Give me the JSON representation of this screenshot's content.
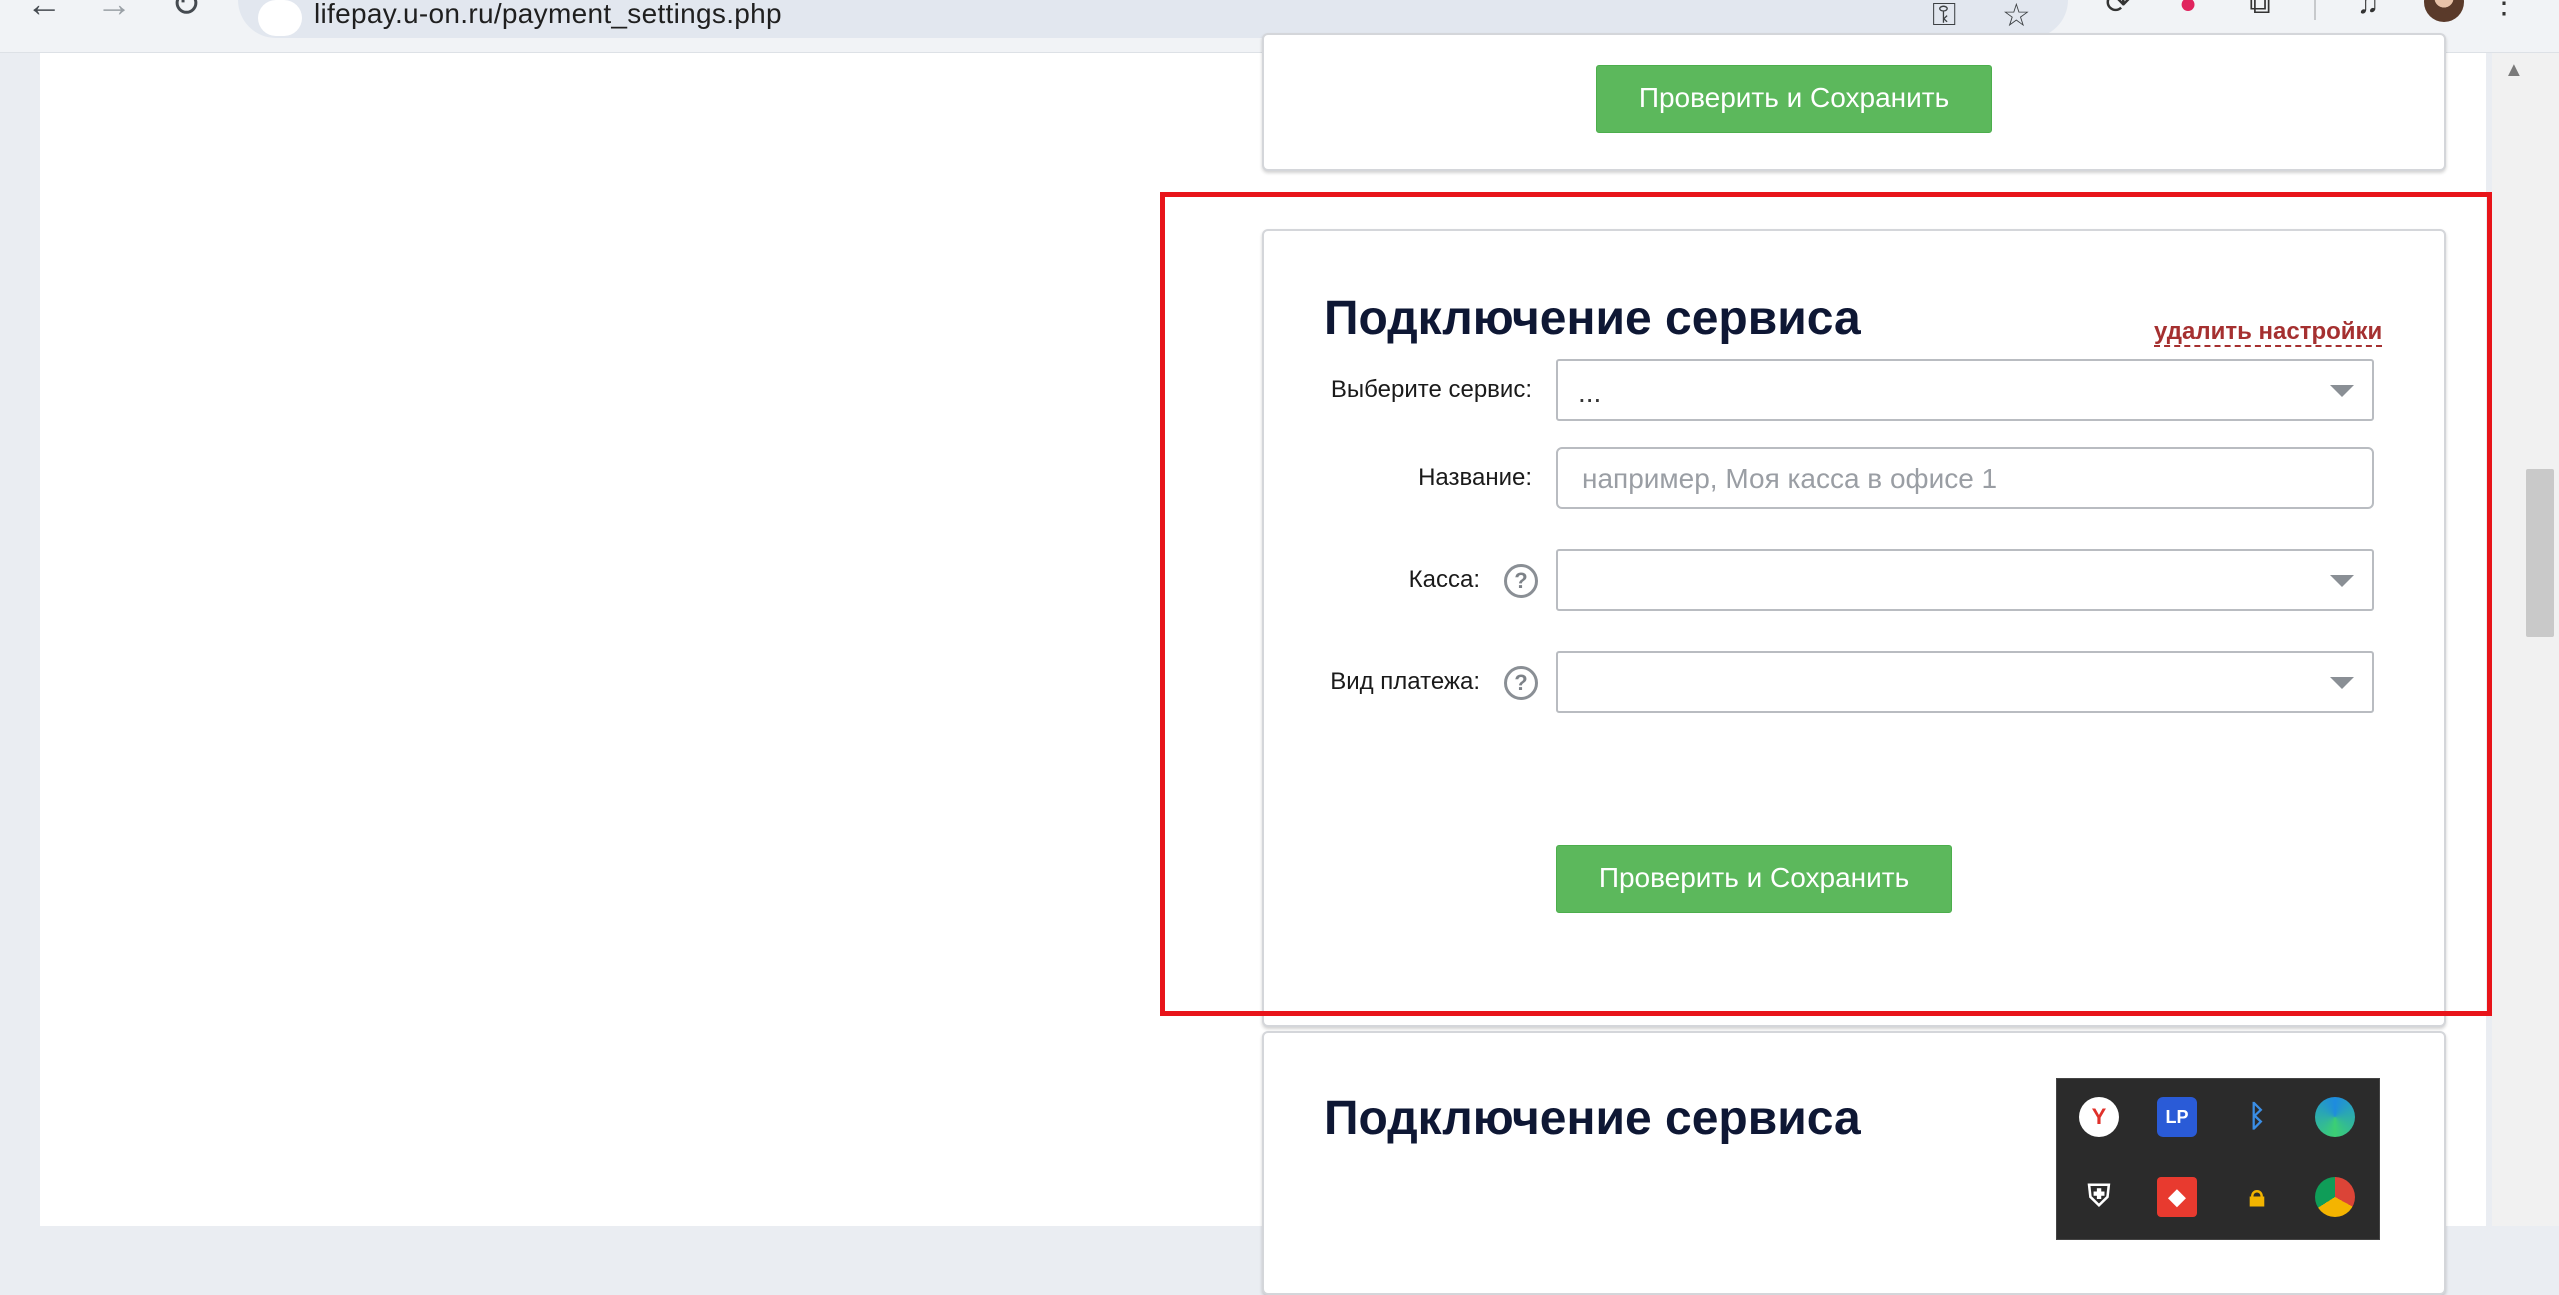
{
  "browser": {
    "url": "lifepay.u-on.ru/payment_settings.php",
    "back_icon": "←",
    "forward_icon": "→",
    "reload_icon": "↻",
    "key_icon": "⚿",
    "star_icon": "☆"
  },
  "top_card": {
    "save_button": "Проверить и Сохранить"
  },
  "service_card": {
    "title": "Подключение сервиса",
    "delete_link": "удалить настройки",
    "service_label": "Выберите сервис:",
    "service_value": "...",
    "name_label": "Название:",
    "name_placeholder": "например, Моя касса в офисе 1",
    "kassa_label": "Касса:",
    "payment_type_label": "Вид платежа:",
    "help_glyph": "?",
    "save_button": "Проверить и Сохранить"
  },
  "next_card": {
    "title": "Подключение сервиса"
  },
  "tray": {
    "lp_label": "LP",
    "yandex_label": "Y"
  },
  "colors": {
    "accent_green": "#5cb85c",
    "highlight_red": "#e8141a",
    "link_red": "#a53030"
  }
}
